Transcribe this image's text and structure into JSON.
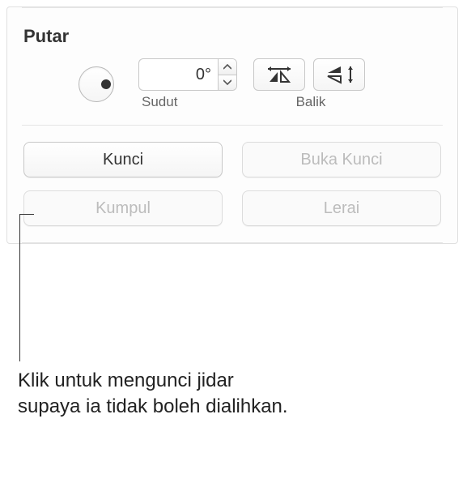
{
  "section": {
    "title": "Putar"
  },
  "rotate": {
    "angle_value": "0°",
    "angle_label": "Sudut",
    "flip_label": "Balik"
  },
  "actions": {
    "lock": "Kunci",
    "unlock": "Buka Kunci",
    "group": "Kumpul",
    "ungroup": "Lerai"
  },
  "callout": {
    "text": "Klik untuk mengunci jidar supaya ia tidak boleh dialihkan."
  }
}
